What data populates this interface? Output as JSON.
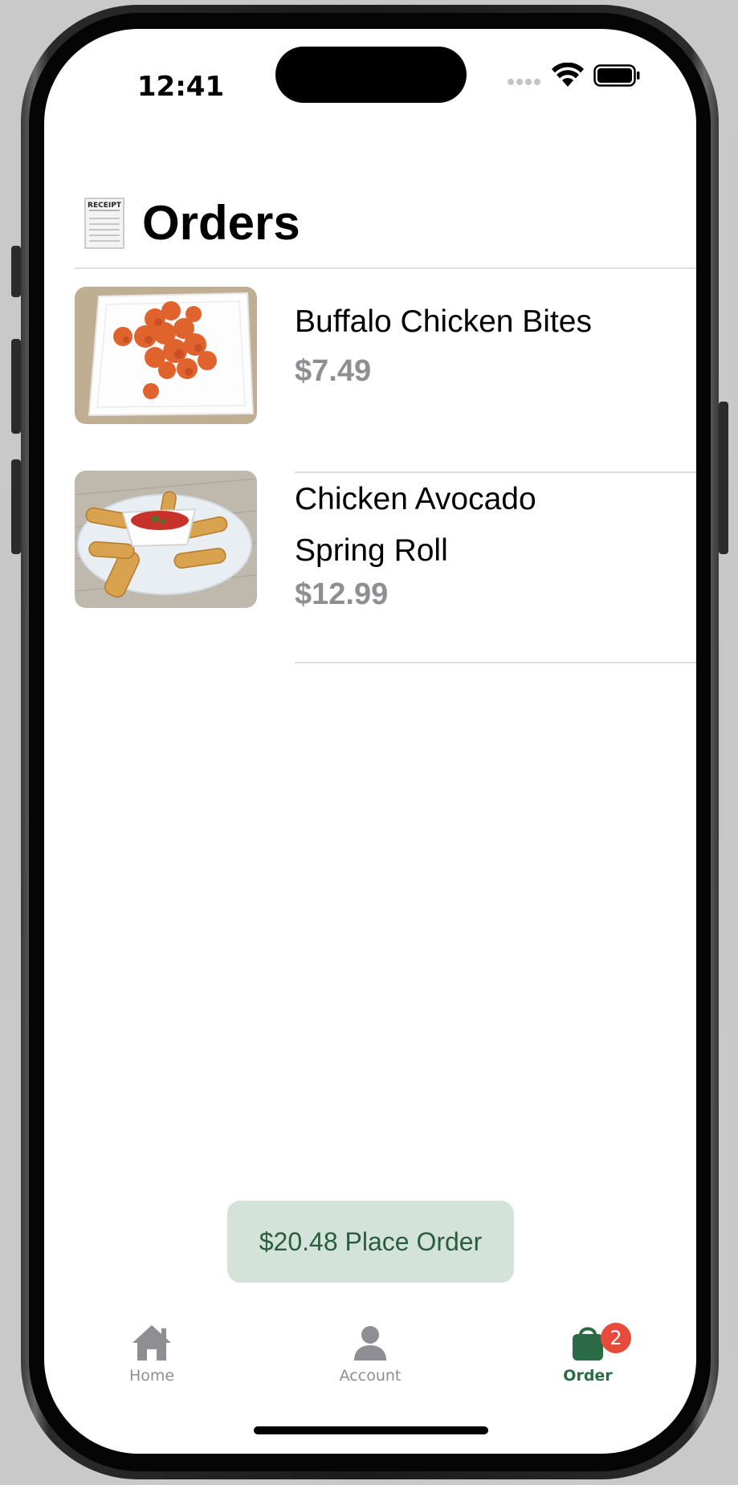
{
  "status_bar": {
    "time": "12:41",
    "icons": [
      "cellular-signal-icon",
      "wifi-icon",
      "battery-icon"
    ]
  },
  "header": {
    "title": "Orders",
    "icon": "receipt-icon",
    "receipt_text": "RECEIPT"
  },
  "orders": [
    {
      "name": "Buffalo Chicken Bites",
      "price": "$7.49",
      "image": "buffalo-chicken-bites-photo"
    },
    {
      "name_line1": "Chicken Avocado",
      "name_line2": "Spring Roll",
      "price": "$12.99",
      "image": "chicken-avocado-spring-roll-photo"
    }
  ],
  "place_order": {
    "label": "$20.48 Place Order"
  },
  "tab_bar": {
    "tabs": [
      {
        "label": "Home",
        "icon": "house-icon",
        "active": false
      },
      {
        "label": "Account",
        "icon": "person-icon",
        "active": false
      },
      {
        "label": "Order",
        "icon": "shopping-bag-icon",
        "active": true,
        "badge": "2"
      }
    ]
  },
  "colors": {
    "accent": "#2a6b45",
    "button_bg": "#d4e3da",
    "button_text": "#2a5d3f",
    "inactive_tab": "#8e8e93",
    "badge": "#e64b3b",
    "price_gray": "#8e8e93"
  }
}
